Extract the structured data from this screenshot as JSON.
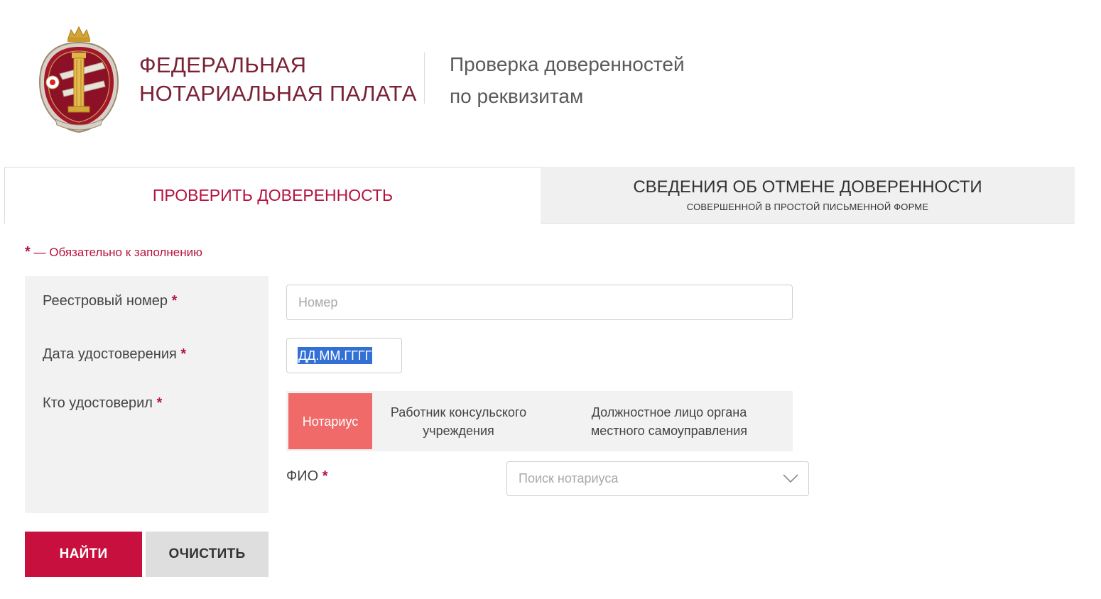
{
  "header": {
    "org_name_line1": "ФЕДЕРАЛЬНАЯ",
    "org_name_line2": "НОТАРИАЛЬНАЯ ПАЛАТА",
    "service_title_line1": "Проверка доверенностей",
    "service_title_line2": "по реквизитам"
  },
  "tabs": [
    {
      "label": "ПРОВЕРИТЬ ДОВЕРЕННОСТЬ",
      "active": true
    },
    {
      "label": "СВЕДЕНИЯ ОБ ОТМЕНЕ ДОВЕРЕННОСТИ",
      "sublabel": "СОВЕРШЕННОЙ В ПРОСТОЙ ПИСЬМЕННОЙ ФОРМЕ",
      "active": false
    }
  ],
  "required_note": {
    "star": "*",
    "text": " — Обязательно к заполнению"
  },
  "form": {
    "registry_number": {
      "label": "Реестровый номер",
      "placeholder": "Номер",
      "value": ""
    },
    "certification_date": {
      "label": "Дата удостоверения",
      "placeholder": "ДД.ММ.ГГГГ"
    },
    "certified_by": {
      "label": "Кто удостоверил",
      "options": [
        "Нотариус",
        "Работник консульского учреждения",
        "Должностное лицо органа местного самоуправления"
      ],
      "selected": "Нотариус"
    },
    "fio": {
      "label": "ФИО",
      "placeholder": "Поиск нотариуса"
    },
    "required_mark": "*"
  },
  "buttons": {
    "find": "НАЙТИ",
    "clear": "ОЧИСТИТЬ"
  },
  "colors": {
    "brand": "#b5123f",
    "primary_button": "#c8103e",
    "selected_option": "#f06a6a",
    "panel_bg": "#f2f2f2"
  }
}
